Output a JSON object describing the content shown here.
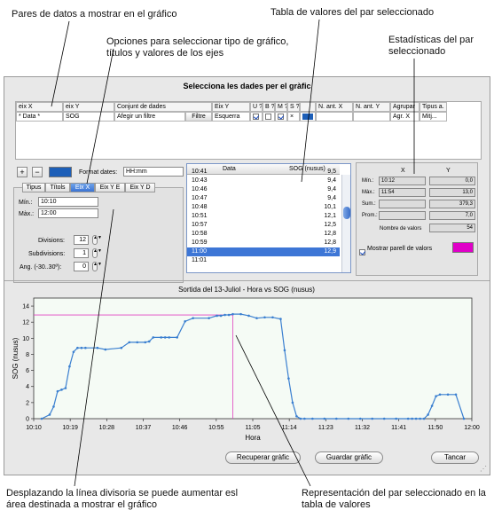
{
  "callouts": {
    "pairs": "Pares de datos a mostrar en el gráfico",
    "table_values": "Tabla de valores del par seleccionado",
    "options": "Opciones para seleccionar tipo de gráfico, títulos y valores de los ejes",
    "stats": "Estadísticas del par seleccionado",
    "divider": "Desplazando la línea divisoria se puede aumentar esl área destinada a mostrar el gráfico",
    "representation": "Representación del par seleccionado en la tabla de valores"
  },
  "window": {
    "title": "Selecciona les dades per el gràfic",
    "columns": [
      "eix X",
      "eix Y",
      "Conjunt de dades",
      "Eix Y",
      "U ?",
      "B ?",
      "M ?",
      "S ?",
      "",
      "N. ant. X",
      "N. ant. Y",
      "Agrupar",
      "Tipus a."
    ],
    "row": {
      "x": "* Data *",
      "y": "SOG",
      "conjunt": "Afegir un filtre",
      "filtre_btn": "Filtre",
      "eix": "Esquerra",
      "s": "×",
      "agrupar": "Agr. X",
      "tipus": "Mitj...",
      "u_checked": true,
      "b_checked": false,
      "m_checked": true,
      "s_checked": false,
      "color": "#1d5fb8"
    },
    "add_label": "+",
    "remove_label": "−",
    "format_label": "Format dates:",
    "format_value": "HH:mm",
    "tabs": [
      "Tipus",
      "Títols",
      "Eix X",
      "Eix Y E",
      "Eix Y D"
    ],
    "selected_tab": "Eix X",
    "min_label": "Mín.:",
    "min_value": "10:10",
    "max_label": "Màx.:",
    "max_value": "12:00",
    "divisions_label": "Divisions:",
    "divisions_value": "12",
    "subdiv_label": "Subdivisions:",
    "subdiv_value": "1",
    "angle_label": "Ang. (-30..30º):",
    "angle_value": "0"
  },
  "value_table": {
    "headers": [
      "Data",
      "SOG (nusus)"
    ],
    "rows": [
      {
        "t": "10:41",
        "v": "9,5"
      },
      {
        "t": "10:43",
        "v": "9,4"
      },
      {
        "t": "10:46",
        "v": "9,4"
      },
      {
        "t": "10:47",
        "v": "9,4"
      },
      {
        "t": "10:48",
        "v": "10,1"
      },
      {
        "t": "10:51",
        "v": "12,1"
      },
      {
        "t": "10:57",
        "v": "12,5"
      },
      {
        "t": "10:58",
        "v": "12,8"
      },
      {
        "t": "10:59",
        "v": "12,8"
      },
      {
        "t": "11:00",
        "v": "12,9"
      },
      {
        "t": "11:01",
        "v": ""
      }
    ],
    "selected_index": 9
  },
  "stats": {
    "col_x": "X",
    "col_y": "Y",
    "min_label": "Mín.:",
    "min_x": "10:12",
    "min_y": "0,0",
    "max_label": "Màx.:",
    "max_x": "11:54",
    "max_y": "13,0",
    "sum_label": "Sum.:",
    "sum_y": "379,3",
    "avg_label": "Prom.:",
    "avg_y": "7,0",
    "count_label": "Nombre de valors",
    "count_y": "54",
    "show_pair_label": "Mostrar parell de valors",
    "show_pair_checked": true,
    "pair_color": "#e000c8"
  },
  "chart_data": {
    "type": "line",
    "title": "Sortida del 13-Juliol  - Hora vs  SOG (nusus)",
    "xlabel": "Hora",
    "ylabel": "SOG (nusus)",
    "x_ticks": [
      "10:10",
      "10:19",
      "10:28",
      "10:37",
      "10:46",
      "10:55",
      "11:05",
      "11:14",
      "11:23",
      "11:32",
      "11:41",
      "11:50",
      "12:00"
    ],
    "xlim_minutes_after_10": [
      10,
      120
    ],
    "y_ticks": [
      "0",
      "2",
      "4",
      "6",
      "8",
      "10",
      "12",
      "14"
    ],
    "ylim": [
      0,
      15
    ],
    "grid": false,
    "line_color": "#3a7fd0",
    "crosshair": {
      "x": "11:00",
      "y": 12.9,
      "color": "#e040c0"
    },
    "series": [
      {
        "x": [
          12,
          14,
          15,
          16,
          17,
          18,
          19,
          20,
          21,
          22,
          23,
          26,
          28,
          32,
          34,
          36,
          38,
          39,
          40,
          42,
          43,
          44,
          46,
          48,
          50,
          54,
          56,
          57,
          58,
          59,
          60,
          62,
          64,
          66,
          68,
          70,
          72,
          73,
          74,
          75,
          76,
          77,
          78,
          80,
          83,
          86,
          89,
          92,
          95,
          98,
          101,
          104,
          105,
          106,
          107,
          108,
          109,
          110,
          111,
          112,
          114,
          116,
          118
        ],
        "y": [
          0,
          0.5,
          1.5,
          3.4,
          3.6,
          3.8,
          6.5,
          8.3,
          8.8,
          8.8,
          8.8,
          8.8,
          8.6,
          8.8,
          9.5,
          9.5,
          9.5,
          9.6,
          10.1,
          10.1,
          10.1,
          10.1,
          10.1,
          12.1,
          12.5,
          12.5,
          12.8,
          12.8,
          12.9,
          12.9,
          13.0,
          13.0,
          12.8,
          12.5,
          12.6,
          12.6,
          12.4,
          8.5,
          5.0,
          2.0,
          0.3,
          0,
          0,
          0,
          0,
          0,
          0,
          0,
          0,
          0,
          0,
          0,
          0,
          0,
          0,
          0,
          0.5,
          1.6,
          2.8,
          3.0,
          3.0,
          3.0,
          0
        ]
      }
    ]
  },
  "buttons": {
    "recover": "Recuperar gràfic",
    "save": "Guardar gràfic",
    "cancel": "Tancar"
  }
}
